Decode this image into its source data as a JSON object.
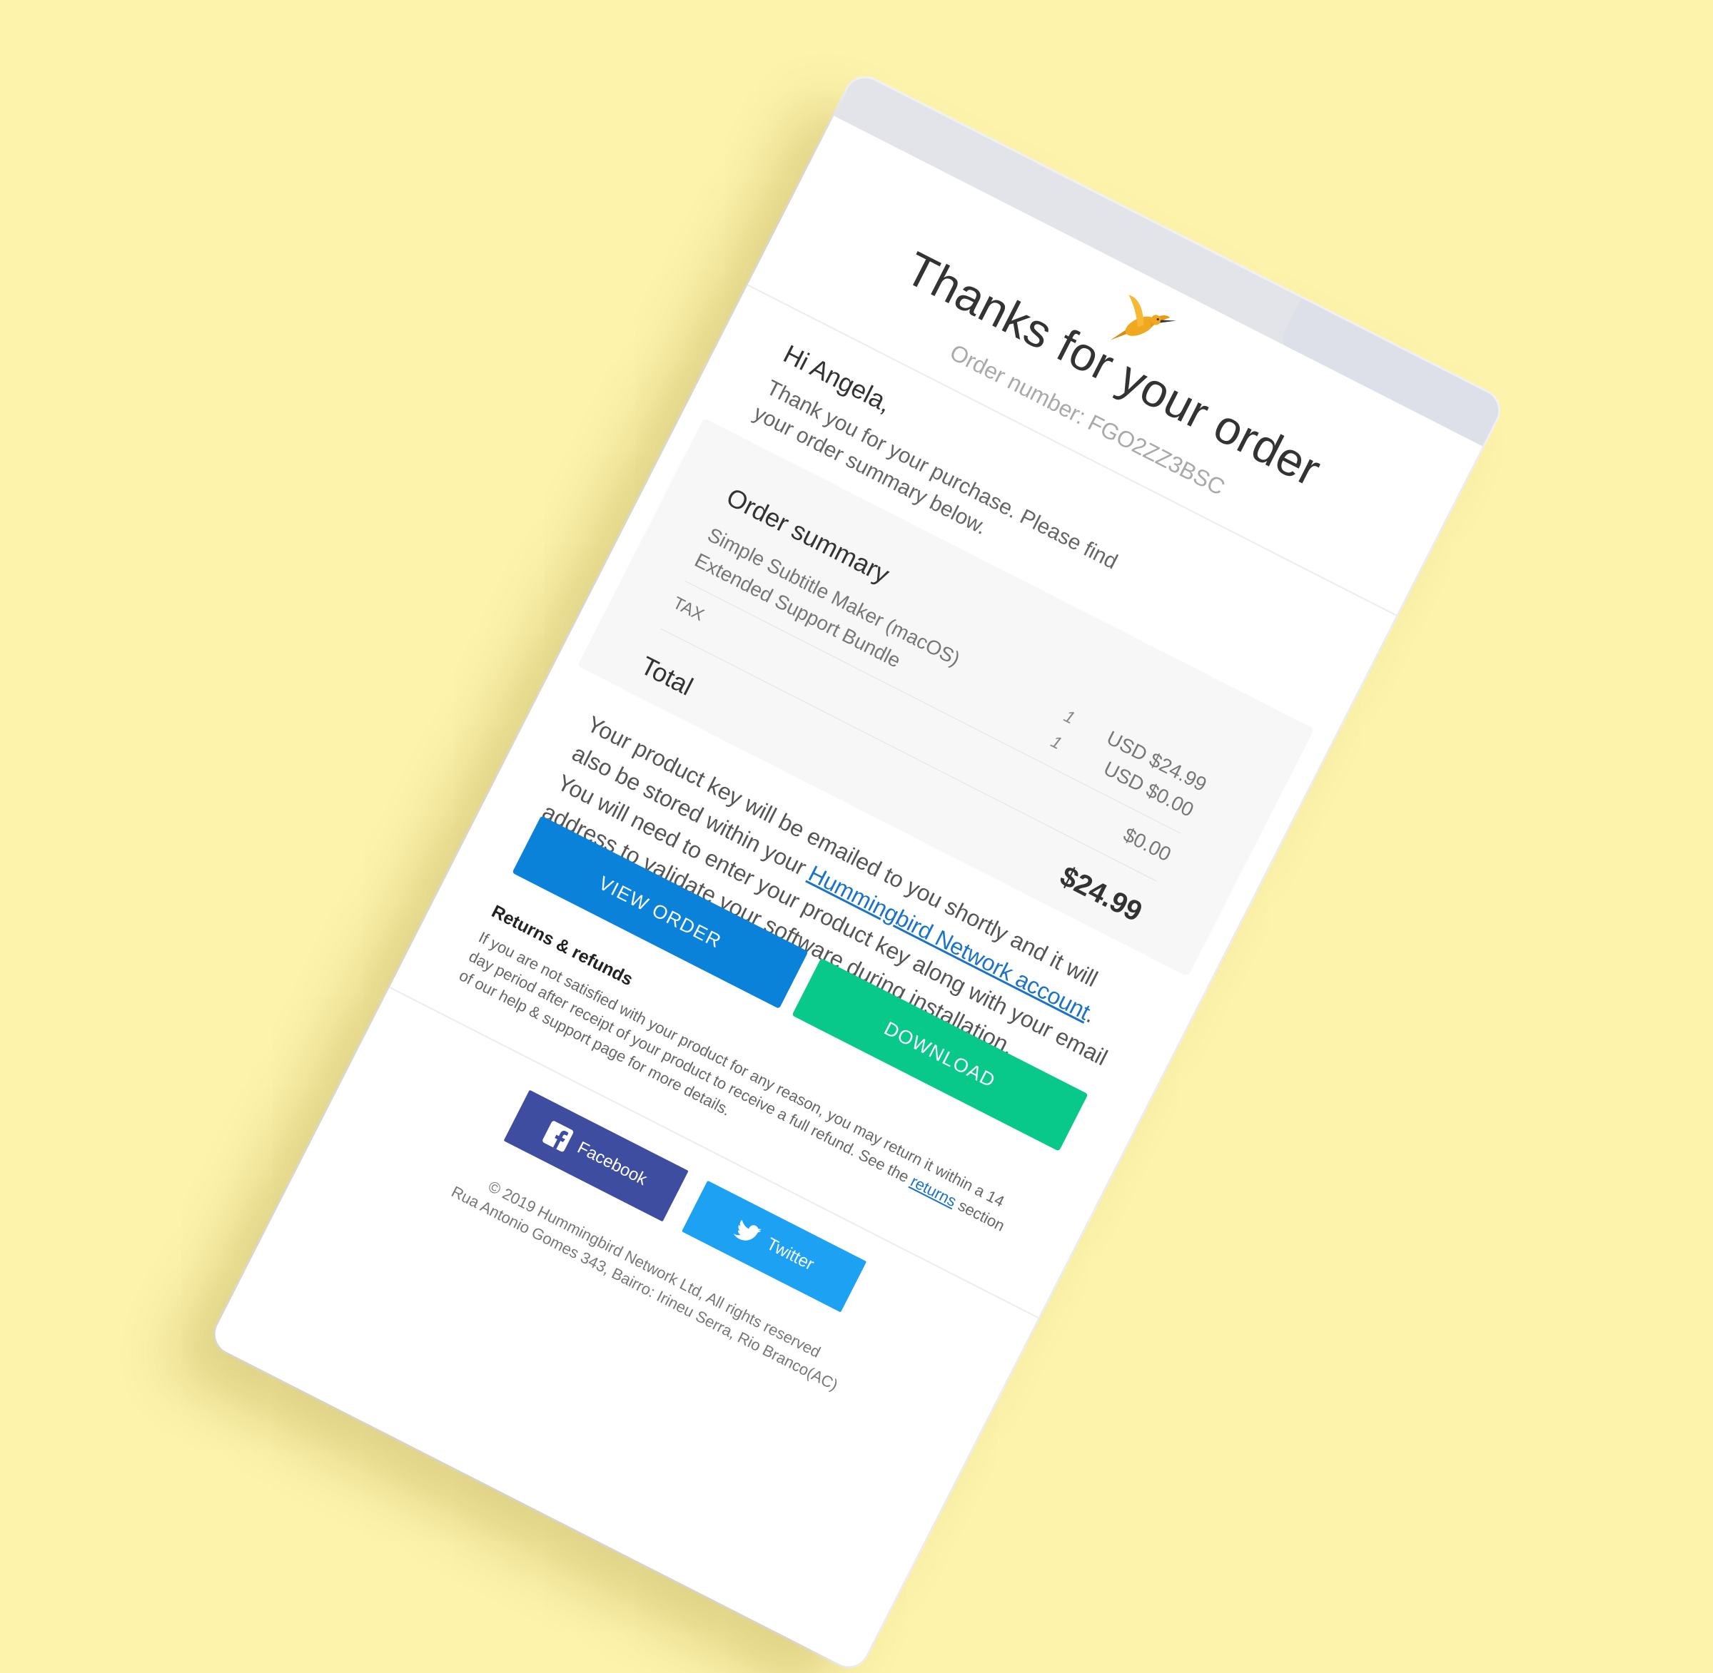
{
  "email": {
    "title": "Thanks for your order",
    "order_number": "Order number: FGO2ZZ3BSC",
    "greeting": "Hi Angela,",
    "intro": "Thank you for your purchase. Please find your order summary below.",
    "summary": {
      "heading": "Order summary",
      "items": [
        {
          "label": "Simple Subtitle Maker (macOS)",
          "qty": "1",
          "price": "USD $24.99"
        },
        {
          "label": "Extended Support Bundle",
          "qty": "1",
          "price": "USD $0.00"
        }
      ],
      "tax_label": "TAX",
      "tax_value": "$0.00",
      "total_label": "Total",
      "total_value": "$24.99"
    },
    "message": {
      "before": "Your product key will be emailed to you shortly and it will also be stored within your ",
      "link": "Hummingbird Network account",
      "after": ". You will need to enter your product key along with your email address to validate your software during installation."
    },
    "buttons": {
      "view_order": "VIEW ORDER",
      "download": "DOWNLOAD"
    },
    "returns": {
      "title": "Returns & refunds",
      "text_before": "If you are not satisfied with your product for any reason, you may return it within a 14 day period after receipt of your product to receive a full refund. See the ",
      "link": "returns",
      "text_after": " section of our help & support page for more details."
    },
    "social": {
      "facebook": "Facebook",
      "twitter": "Twitter"
    },
    "footer": {
      "copyright": "© 2019 Hummingbird Network Ltd, All rights reserved",
      "address": "Rua Antonio Gomes 343, Bairro: Irineu Serra, Rio Branco(AC)"
    }
  },
  "icons": {
    "logo": "hummingbird-logo",
    "facebook": "facebook-icon",
    "twitter": "twitter-icon"
  },
  "colors": {
    "background": "#fdf3ab",
    "view_order_button": "#0b82d9",
    "download_button": "#08c98a",
    "facebook": "#3f4da0",
    "twitter": "#1da1f2",
    "link": "#1a73c8",
    "logo": "#f0a820"
  }
}
